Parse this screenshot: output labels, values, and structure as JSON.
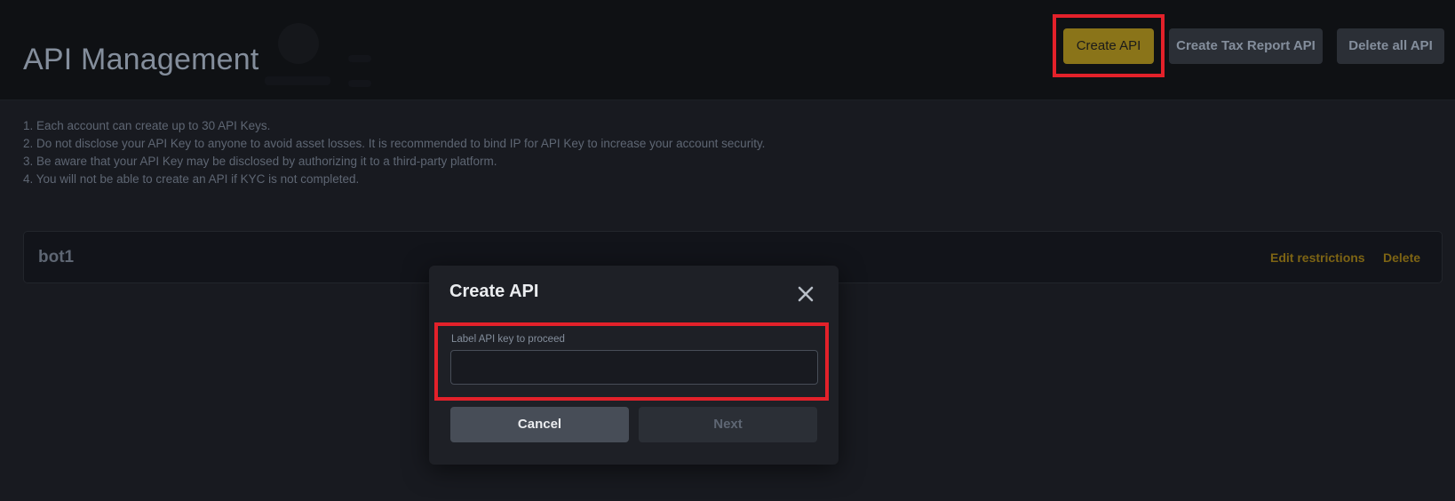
{
  "header": {
    "title": "API Management",
    "buttons": {
      "create_api": "Create API",
      "create_tax_report_api": "Create Tax Report API",
      "delete_all_api": "Delete all API"
    }
  },
  "notes": [
    "1. Each account can create up to 30 API Keys.",
    "2. Do not disclose your API Key to anyone to avoid asset losses. It is recommended to bind IP for API Key to increase your account security.",
    "3. Be aware that your API Key may be disclosed by authorizing it to a third-party platform.",
    "4. You will not be able to create an API if KYC is not completed."
  ],
  "api_keys": [
    {
      "name": "bot1",
      "edit_label": "Edit restrictions",
      "delete_label": "Delete"
    }
  ],
  "modal": {
    "title": "Create API",
    "close_icon": "close-icon",
    "field_label": "Label API key to proceed",
    "field_value": "",
    "field_placeholder": "",
    "cancel_label": "Cancel",
    "next_label": "Next"
  },
  "colors": {
    "accent": "#8a7419",
    "link": "#7d6414",
    "highlight": "#e3212a",
    "background": "#181a20",
    "modal_background": "#1e2026"
  }
}
